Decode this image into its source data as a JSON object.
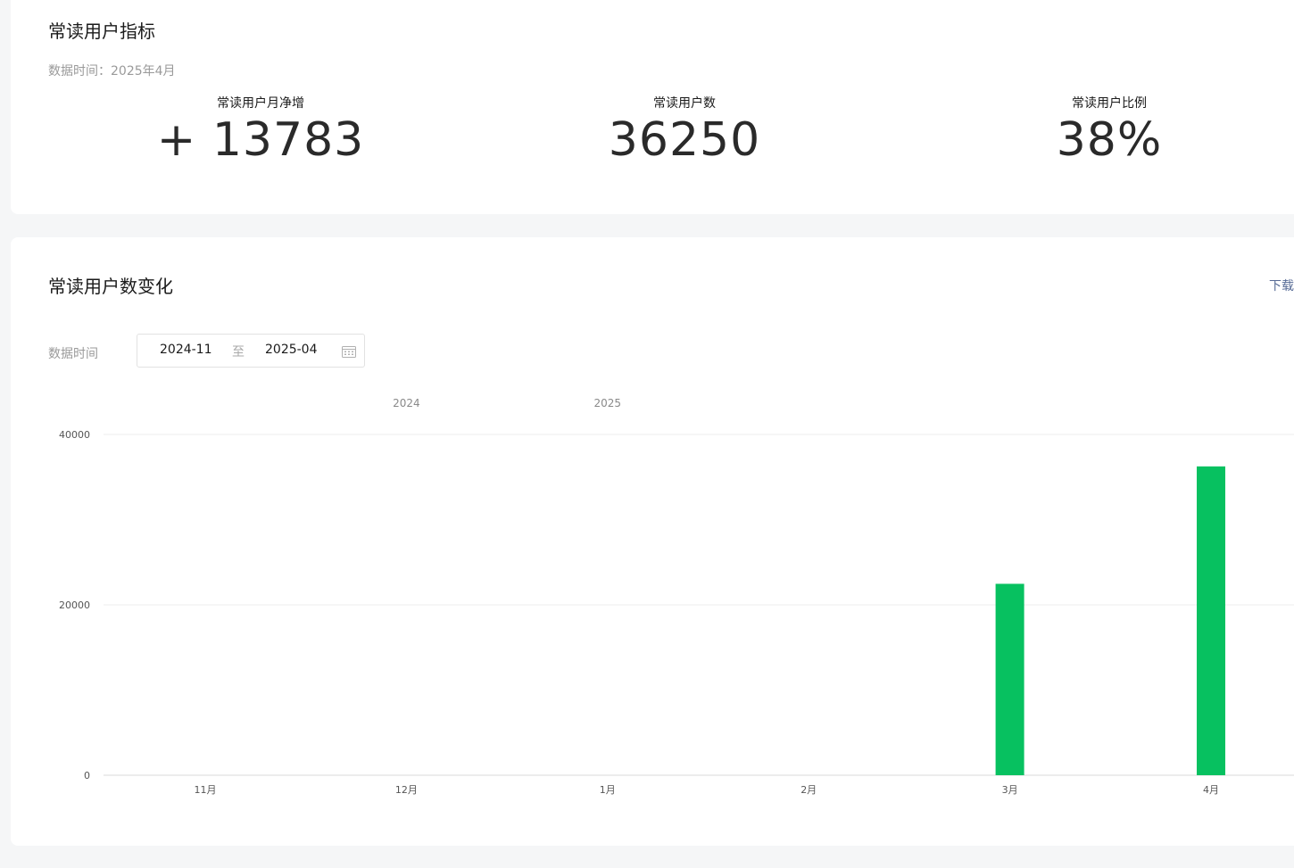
{
  "metrics_card": {
    "title": "常读用户指标",
    "data_time": "数据时间：2025年4月",
    "metrics": [
      {
        "label": "常读用户月净增",
        "value": "+ 13783"
      },
      {
        "label": "常读用户数",
        "value": "36250"
      },
      {
        "label": "常读用户比例",
        "value": "38%"
      }
    ]
  },
  "chart_card": {
    "title": "常读用户数变化",
    "download_label": "下载",
    "filter_label": "数据时间",
    "date_start": "2024-11",
    "date_separator": "至",
    "date_end": "2025-04",
    "calendar_icon": "calendar-icon"
  },
  "colors": {
    "bar": "#07c160",
    "accent_link": "#576b95"
  },
  "chart_data": {
    "type": "bar",
    "categories": [
      "11月",
      "12月",
      "1月",
      "2月",
      "3月",
      "4月"
    ],
    "year_labels": [
      "2024",
      "2025"
    ],
    "values": [
      0,
      0,
      0,
      0,
      22467,
      36250
    ],
    "ylim": [
      0,
      40000
    ],
    "yticks": [
      0,
      20000,
      40000
    ],
    "grid": true,
    "title": "",
    "xlabel": "",
    "ylabel": ""
  }
}
